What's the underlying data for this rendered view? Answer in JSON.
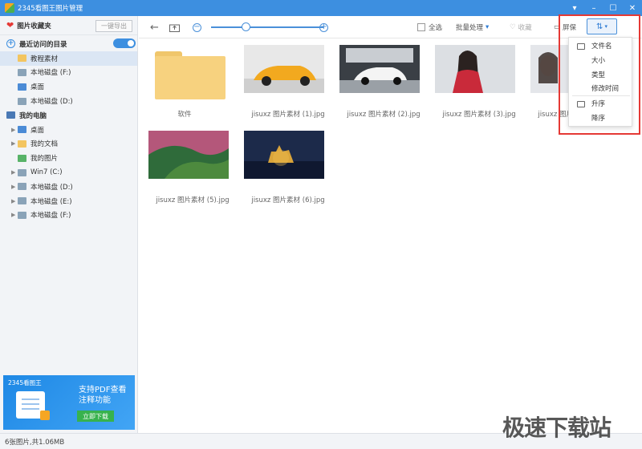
{
  "window": {
    "title": "2345看图王图片管理",
    "controls": [
      "▾",
      "–",
      "☐",
      "✕"
    ]
  },
  "sidebar": {
    "favorites_title": "图片收藏夹",
    "export_label": "一键导出",
    "recent_title": "最近访问的目录",
    "recent_items": [
      {
        "label": "教程素材",
        "icon": "folder-icon",
        "selected": true
      },
      {
        "label": "本地磁盘 (F:)",
        "icon": "disk-icon"
      },
      {
        "label": "桌面",
        "icon": "desktop-icon"
      },
      {
        "label": "本地磁盘 (D:)",
        "icon": "disk-icon"
      }
    ],
    "computer_title": "我的电脑",
    "computer_items": [
      {
        "label": "桌面",
        "icon": "desktop-icon",
        "expandable": true
      },
      {
        "label": "我的文档",
        "icon": "folder-icon",
        "expandable": true
      },
      {
        "label": "我的图片",
        "icon": "picture-icon",
        "expandable": false
      },
      {
        "label": "Win7 (C:)",
        "icon": "disk-icon",
        "expandable": true
      },
      {
        "label": "本地磁盘 (D:)",
        "icon": "disk-icon",
        "expandable": true
      },
      {
        "label": "本地磁盘 (E:)",
        "icon": "disk-icon",
        "expandable": true
      },
      {
        "label": "本地磁盘 (F:)",
        "icon": "disk-icon",
        "expandable": true
      }
    ]
  },
  "ad": {
    "brand": "2345看图王",
    "line1": "支持PDF查看",
    "line2": "注释功能",
    "button": "立即下载"
  },
  "toolbar": {
    "select_all": "全选",
    "batch": "批量处理",
    "favorite": "收藏",
    "screensaver": "屏保",
    "sort_icon": "sort-icon",
    "zoom_level": 0.3
  },
  "files": [
    {
      "name": "软件",
      "type": "folder"
    },
    {
      "name": "jisuxz 图片素材 (1).jpg",
      "type": "image"
    },
    {
      "name": "jisuxz 图片素材 (2).jpg",
      "type": "image"
    },
    {
      "name": "jisuxz 图片素材 (3).jpg",
      "type": "image"
    },
    {
      "name": "jisuxz 图片素材 (4).jpg",
      "type": "image"
    },
    {
      "name": "jisuxz 图片素材 (5).jpg",
      "type": "image"
    },
    {
      "name": "jisuxz 图片素材 (6).jpg",
      "type": "image"
    }
  ],
  "sort_menu": {
    "items": [
      "文件名",
      "大小",
      "类型",
      "修改时间"
    ],
    "order": [
      "升序",
      "降序"
    ]
  },
  "status": {
    "text": "6张图片,共1.06MB"
  },
  "watermark": "极速下载站",
  "colors": {
    "accent": "#3d8fe0",
    "highlight": "#e53935"
  }
}
